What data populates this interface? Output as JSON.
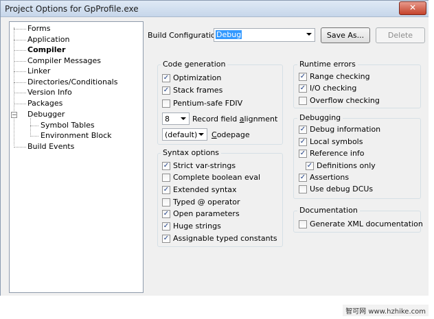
{
  "window": {
    "title": "Project Options for GpProfile.exe",
    "close_symbol": "✕"
  },
  "tree": {
    "items": [
      {
        "label": "Forms"
      },
      {
        "label": "Application"
      },
      {
        "label": "Compiler"
      },
      {
        "label": "Compiler Messages"
      },
      {
        "label": "Linker"
      },
      {
        "label": "Directories/Conditionals"
      },
      {
        "label": "Version Info"
      },
      {
        "label": "Packages"
      },
      {
        "label": "Debugger",
        "expander": "−"
      },
      {
        "label": "Symbol Tables"
      },
      {
        "label": "Environment Block"
      },
      {
        "label": "Build Events"
      }
    ],
    "selected": "Compiler"
  },
  "build_config": {
    "label": "Build Configuratio",
    "value": "Debug",
    "save_as": "Save As...",
    "delete": "Delete"
  },
  "code_generation": {
    "title": "Code generation",
    "items": [
      {
        "label": "Optimization",
        "checked": true
      },
      {
        "label": "Stack frames",
        "checked": true
      },
      {
        "label": "Pentium-safe FDIV",
        "checked": false
      }
    ],
    "record_align_value": "8",
    "record_align_label": "Record field alignment",
    "codepage_value": "(default)",
    "codepage_label": "Codepage"
  },
  "syntax_options": {
    "title": "Syntax options",
    "items": [
      {
        "label": "Strict var-strings",
        "checked": true
      },
      {
        "label": "Complete boolean eval",
        "checked": false
      },
      {
        "label": "Extended syntax",
        "checked": true
      },
      {
        "label": "Typed @ operator",
        "checked": false
      },
      {
        "label": "Open parameters",
        "checked": true
      },
      {
        "label": "Huge strings",
        "checked": true
      },
      {
        "label": "Assignable typed constants",
        "checked": true
      }
    ]
  },
  "runtime_errors": {
    "title": "Runtime errors",
    "items": [
      {
        "label": "Range checking",
        "checked": true
      },
      {
        "label": "I/O checking",
        "checked": true
      },
      {
        "label": "Overflow checking",
        "checked": false
      }
    ]
  },
  "debugging": {
    "title": "Debugging",
    "items": [
      {
        "label": "Debug information",
        "checked": true
      },
      {
        "label": "Local symbols",
        "checked": true
      },
      {
        "label": "Reference info",
        "checked": true
      },
      {
        "label": "Definitions only",
        "checked": true
      },
      {
        "label": "Assertions",
        "checked": true
      },
      {
        "label": "Use debug DCUs",
        "checked": false
      }
    ]
  },
  "documentation": {
    "title": "Documentation",
    "items": [
      {
        "label": "Generate XML documentation",
        "checked": false
      }
    ]
  },
  "watermark": "智可网 www.hzhike.com",
  "colors": {
    "accent": "#3399ff",
    "titlebar": "#c6d6ea",
    "close": "#c4422b"
  }
}
